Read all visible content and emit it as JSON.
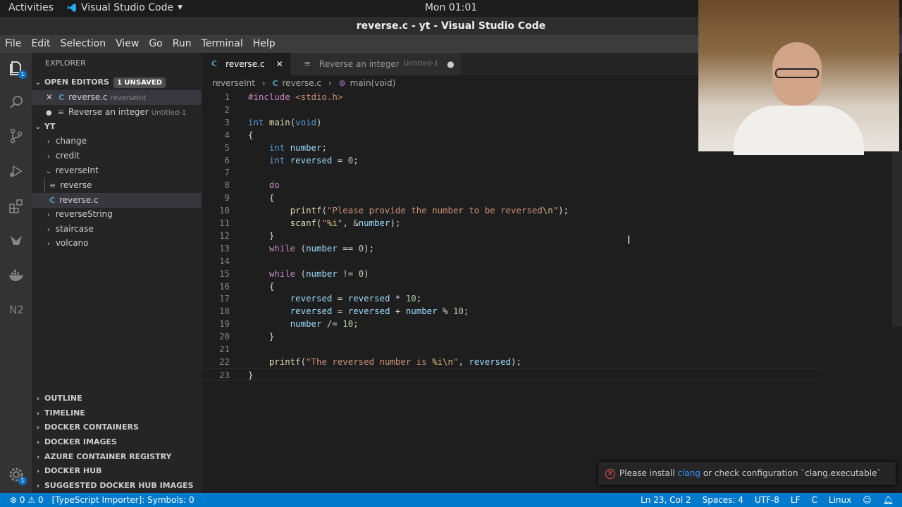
{
  "top_bar": {
    "activities": "Activities",
    "app_name": "Visual Studio Code",
    "clock": "Mon 01:01"
  },
  "window_title": "reverse.c - yt - Visual Studio Code",
  "menu": [
    "File",
    "Edit",
    "Selection",
    "View",
    "Go",
    "Run",
    "Terminal",
    "Help"
  ],
  "activity_bar": {
    "explorer_badge": "1"
  },
  "sidebar": {
    "title": "EXPLORER",
    "open_editors": {
      "label": "OPEN EDITORS",
      "unsaved": "1 UNSAVED",
      "items": [
        {
          "name": "reverse.c",
          "hint": "reverseInt",
          "icon": "C"
        },
        {
          "name": "Reverse an integer",
          "hint": "Untitled-1",
          "icon": "≡"
        }
      ]
    },
    "workspace": {
      "label": "YT",
      "folders": [
        "change",
        "credit",
        "reverseInt",
        "reverseString",
        "staircase",
        "volcano"
      ],
      "reverseInt_children": [
        "reverse",
        "reverse.c"
      ]
    },
    "sections": [
      "OUTLINE",
      "TIMELINE",
      "DOCKER CONTAINERS",
      "DOCKER IMAGES",
      "AZURE CONTAINER REGISTRY",
      "DOCKER HUB",
      "SUGGESTED DOCKER HUB IMAGES"
    ]
  },
  "tabs": [
    {
      "label": "reverse.c",
      "icon": "C",
      "active": true
    },
    {
      "label": "Reverse an integer",
      "hint": "Untitled-1",
      "icon": "≡",
      "active": false
    }
  ],
  "breadcrumb": {
    "folder": "reverseInt",
    "file": "reverse.c",
    "symbol": "main(void)"
  },
  "code_lines": [
    "#include <stdio.h>",
    "",
    "int main(void)",
    "{",
    "    int number;",
    "    int reversed = 0;",
    "",
    "    do",
    "    {",
    "        printf(\"Please provide the number to be reversed\\n\");",
    "        scanf(\"%i\", &number);",
    "    }",
    "    while (number == 0);",
    "",
    "    while (number != 0)",
    "    {",
    "        reversed = reversed * 10;",
    "        reversed = reversed + number % 10;",
    "        number /= 10;",
    "    }",
    "",
    "    printf(\"The reversed number is %i\\n\", reversed);",
    "}"
  ],
  "notification": {
    "before": "Please install ",
    "link": "clang",
    "after": " or check configuration `clang.executable`"
  },
  "status_bar": {
    "errors": "0",
    "warnings": "0",
    "importer": "[TypeScript Importer]: Symbols: 0",
    "position": "Ln 23, Col 2",
    "spaces": "Spaces: 4",
    "encoding": "UTF-8",
    "eol": "LF",
    "language": "C",
    "platform": "Linux"
  },
  "colors": {
    "accent": "#007acc",
    "editor_bg": "#1e1e1e",
    "sidebar_bg": "#252526"
  }
}
